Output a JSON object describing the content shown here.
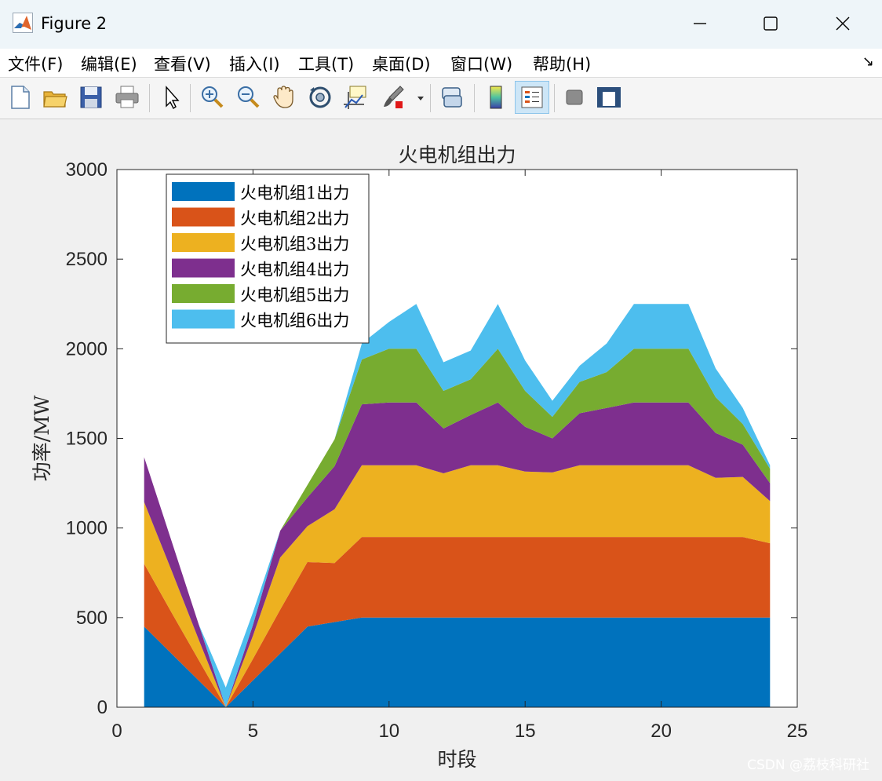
{
  "window": {
    "title": "Figure 2",
    "controls": {
      "minimize": "—",
      "maximize": "☐",
      "close": "✕"
    }
  },
  "menu": {
    "items": [
      "文件(F)",
      "编辑(E)",
      "查看(V)",
      "插入(I)",
      "工具(T)",
      "桌面(D)",
      "窗口(W)",
      "帮助(H)"
    ],
    "dock_arrow": "↘"
  },
  "toolbar": {
    "icons": [
      "new-figure-icon",
      "open-file-icon",
      "save-icon",
      "print-icon",
      "pointer-icon",
      "zoom-in-icon",
      "zoom-out-icon",
      "pan-hand-icon",
      "rotate-3d-icon",
      "data-cursor-icon",
      "brush-icon",
      "link-plot-icon",
      "colorbar-icon",
      "legend-icon",
      "hide-plot-tools-icon",
      "show-plot-tools-icon"
    ]
  },
  "chart_data": {
    "type": "area",
    "stacked": true,
    "title": "火电机组出力",
    "xlabel": "时段",
    "ylabel": "功率/MW",
    "xlim": [
      0,
      25
    ],
    "ylim": [
      0,
      3000
    ],
    "xticks": [
      0,
      5,
      10,
      15,
      20,
      25
    ],
    "yticks": [
      0,
      500,
      1000,
      1500,
      2000,
      2500,
      3000
    ],
    "grid": false,
    "legend_position": "top-left",
    "x": [
      1,
      2,
      3,
      4,
      5,
      6,
      7,
      8,
      9,
      10,
      11,
      12,
      13,
      14,
      15,
      16,
      17,
      18,
      19,
      20,
      21,
      22,
      23,
      24
    ],
    "series": [
      {
        "name": "火电机组1出力",
        "color": "#0072BD",
        "values": [
          450,
          300,
          150,
          0,
          150,
          300,
          450,
          475,
          500,
          500,
          500,
          500,
          500,
          500,
          500,
          500,
          500,
          500,
          500,
          500,
          500,
          500,
          500,
          500
        ]
      },
      {
        "name": "火电机组2出力",
        "color": "#D95319",
        "values": [
          350,
          230,
          115,
          0,
          120,
          245,
          360,
          330,
          450,
          450,
          450,
          450,
          450,
          450,
          450,
          450,
          450,
          450,
          450,
          450,
          450,
          450,
          450,
          415
        ]
      },
      {
        "name": "火电机组3出力",
        "color": "#EDB120",
        "values": [
          345,
          235,
          115,
          0,
          130,
          290,
          200,
          300,
          400,
          400,
          400,
          355,
          400,
          400,
          365,
          360,
          400,
          400,
          400,
          400,
          400,
          330,
          335,
          235
        ]
      },
      {
        "name": "火电机组4出力",
        "color": "#7E2F8E",
        "values": [
          250,
          165,
          85,
          0,
          60,
          150,
          160,
          240,
          340,
          350,
          350,
          250,
          280,
          350,
          250,
          190,
          290,
          320,
          350,
          350,
          350,
          250,
          180,
          100
        ]
      },
      {
        "name": "火电机组5出力",
        "color": "#77AC30",
        "values": [
          0,
          0,
          0,
          0,
          0,
          0,
          70,
          150,
          250,
          300,
          300,
          210,
          200,
          300,
          200,
          120,
          175,
          200,
          300,
          300,
          300,
          200,
          115,
          80
        ]
      },
      {
        "name": "火电机组6出力",
        "color": "#4DBEEE",
        "values": [
          0,
          0,
          0,
          110,
          70,
          0,
          0,
          0,
          90,
          150,
          250,
          160,
          160,
          250,
          170,
          90,
          90,
          160,
          250,
          250,
          250,
          160,
          90,
          20
        ]
      }
    ]
  },
  "watermark": "CSDN @荔枝科研社"
}
